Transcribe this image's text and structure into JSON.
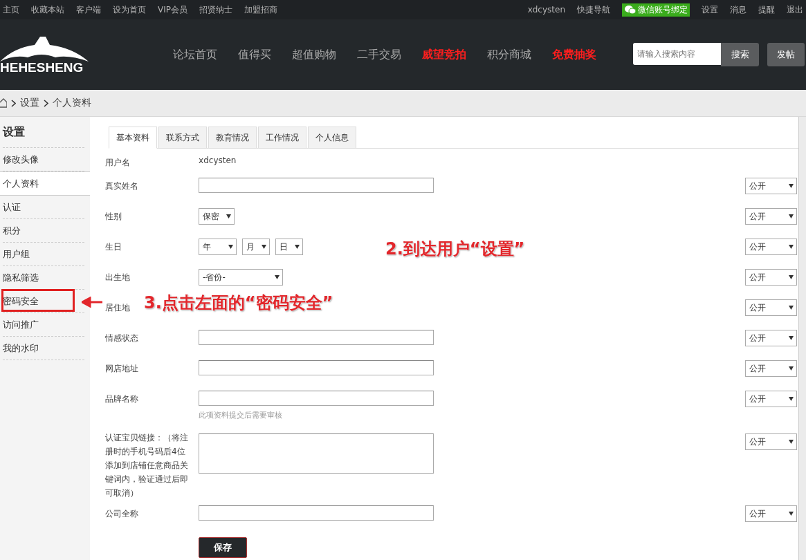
{
  "top_links": [
    "主页",
    "收藏本站",
    "客户端",
    "设为首页",
    "VIP会员",
    "招贤纳士",
    "加盟招商"
  ],
  "user_bar": {
    "username": "xdcysten",
    "quick_nav": "快捷导航",
    "wechat_bind": "微信账号绑定",
    "links": [
      "设置",
      "消息",
      "提醒",
      "退出"
    ]
  },
  "logo": "HEHESHENG",
  "nav": [
    {
      "label": "论坛首页",
      "highlight": false
    },
    {
      "label": "值得买",
      "highlight": false
    },
    {
      "label": "超值购物",
      "highlight": false
    },
    {
      "label": "二手交易",
      "highlight": false
    },
    {
      "label": "威望竞拍",
      "highlight": true
    },
    {
      "label": "积分商城",
      "highlight": false
    },
    {
      "label": "免费抽奖",
      "highlight": true
    }
  ],
  "search": {
    "placeholder": "请输入搜索内容",
    "button": "搜索"
  },
  "post_button": "发帖",
  "breadcrumb": [
    "设置",
    "个人资料"
  ],
  "sidebar": {
    "title": "设置",
    "items": [
      {
        "label": "修改头像",
        "selected": false,
        "circled": false
      },
      {
        "label": "个人资料",
        "selected": true,
        "circled": false
      },
      {
        "label": "认证",
        "selected": false,
        "circled": false
      },
      {
        "label": "积分",
        "selected": false,
        "circled": false
      },
      {
        "label": "用户组",
        "selected": false,
        "circled": false
      },
      {
        "label": "隐私筛选",
        "selected": false,
        "circled": false
      },
      {
        "label": "密码安全",
        "selected": false,
        "circled": true
      },
      {
        "label": "访问推广",
        "selected": false,
        "circled": false
      },
      {
        "label": "我的水印",
        "selected": false,
        "circled": false
      }
    ]
  },
  "tabs": [
    {
      "label": "基本资料",
      "selected": true
    },
    {
      "label": "联系方式",
      "selected": false
    },
    {
      "label": "教育情况",
      "selected": false
    },
    {
      "label": "工作情况",
      "selected": false
    },
    {
      "label": "个人信息",
      "selected": false
    }
  ],
  "fields": [
    {
      "label": "用户名",
      "kind": "text",
      "value": "xdcysten"
    },
    {
      "label": "真实姓名",
      "kind": "input",
      "privacy": "公开"
    },
    {
      "label": "性别",
      "kind": "selects",
      "options": [
        "保密"
      ],
      "privacy": "公开"
    },
    {
      "label": "生日",
      "kind": "selects",
      "options": [
        "年",
        "月",
        "日"
      ],
      "privacy": "公开"
    },
    {
      "label": "出生地",
      "kind": "selects",
      "options": [
        "-省份-"
      ],
      "privacy": "公开"
    },
    {
      "label": "居住地",
      "kind": "covered",
      "privacy": "公开"
    },
    {
      "label": "情感状态",
      "kind": "input",
      "privacy": "公开"
    },
    {
      "label": "网店地址",
      "kind": "input",
      "privacy": "公开"
    },
    {
      "label": "品牌名称",
      "kind": "input",
      "hint": "此项资料提交后需要审核",
      "privacy": "公开"
    },
    {
      "label": "认证宝贝链接：（将注册时的手机号码后4位添加到店铺任意商品关键词内，验证通过后即可取消）",
      "kind": "textarea",
      "privacy": "公开"
    },
    {
      "label": "公司全称",
      "kind": "input",
      "privacy": "公开"
    }
  ],
  "save_button": "保存",
  "annotations": [
    {
      "text": "2.到达用户“设置”",
      "kind": "note"
    },
    {
      "text": "3.点击左面的“密码安全”",
      "kind": "pointer"
    }
  ]
}
